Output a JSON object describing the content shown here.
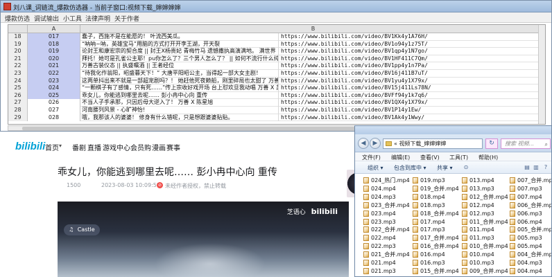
{
  "main_window": {
    "title": "刘八课_词链流_爆款仿选器 - 当前子窗口:视频下载_婶婶婶婶",
    "menus": [
      "爆款仿选",
      "调试输出",
      "小工具",
      "法律声明",
      "关于作者"
    ]
  },
  "sheet": {
    "col_headers": [
      "A",
      "B"
    ],
    "rows": [
      {
        "n": "18",
        "a": "017",
        "b": "蠢子，西施不是在能愿的！ 叶流西美瓜。",
        "c": "https://www.bilibili.com/video/BV1Kk4y1A76H/",
        "hl": true
      },
      {
        "n": "19",
        "a": "018",
        "b": "“呐呐~呐，英雄宝马”用脑的方式打开开李王湖，开天裂",
        "c": "https://www.bilibili.com/video/BV1o94y1z75T/",
        "hl": true
      },
      {
        "n": "20",
        "a": "019",
        "b": "论封王和康宏宗的契合度 || 封王X杨贵妃  青梅竹马 遗憾撒执高演满地。 满世界",
        "c": "https://www.bilibili.com/video/BV1qp4y1N7go/",
        "hl": true
      },
      {
        "n": "21",
        "a": "020",
        "b": "拜托！她可是孔雀公主耶！pu你怎么了？三个男人怎么了？ || 如何不流行什么纯爱，我",
        "c": "https://www.bilibili.com/video/BV1HF411C7Qm/",
        "hl": true
      },
      {
        "n": "22",
        "a": "021",
        "b": "万善古装仪态 || 执盛嘱酒 || 王者经位",
        "c": "https://www.bilibili.com/video/BV1pp4y1n7Pa/",
        "hl": true
      },
      {
        "n": "23",
        "a": "022",
        "b": "“待我化作翁阳，昭盛暮天下！” 大唐平阳昭公主，当得起一部大女主剧！",
        "c": "https://www.bilibili.com/video/BV16j411B7uT/",
        "hl": true
      },
      {
        "n": "24",
        "a": "023",
        "b": "这两单抖出来不就是一部超宠剧吗？！ 她赶他死夜赖船，刚里碎局也太甜了 万善 X 吴",
        "c": "https://www.bilibili.com/video/BV1yu4y1X79x/",
        "hl": true
      },
      {
        "n": "25",
        "a": "024",
        "b": "“一颗棋子有了感情，只有死……”传上宗收好戏开场  台上怼欢旦我动唱  万善 X 苏雅",
        "c": "https://www.bilibili.com/video/BV15j411Ls78N/",
        "hl": true
      },
      {
        "n": "26",
        "a": "025",
        "b": "乖女儿，你能逃到哪里去呢…… 彭小冉中心向  重传",
        "c": "https://www.bilibili.com/video/BVFf94y1k7q6/",
        "hl": true
      },
      {
        "n": "27",
        "a": "026",
        "b": "不当人子手承那，只因后母大逆入了！  万善 X 陈星旭",
        "c": "https://www.bilibili.com/video/BV1QX4y1X79x/",
        "hl": false
      },
      {
        "n": "28",
        "a": "027",
        "b": "河南腰列风景 - 心旷神怡!",
        "c": "https://www.bilibili.com/video/BV1P14y1Ew/",
        "hl": false
      },
      {
        "n": "29",
        "a": "028",
        "b": "哦，我那该人的婆婆！ 修身有什么错呢，只是想跟婆婆贴贴。",
        "c": "https://www.bilibili.com/video/BV1Ak4y1Wwy/",
        "hl": false
      }
    ]
  },
  "bili_nav": {
    "logo": "bilibili",
    "items": [
      "首页",
      "番剧",
      "直播",
      "游戏中心",
      "会员购",
      "漫画",
      "赛事"
    ]
  },
  "video": {
    "title": "乖女儿，你能逃到哪里去呢…… 彭小冉中心向 重传",
    "views": "1500",
    "datetime": "2023-08-03 10:09:57",
    "notice": "未经作者授权，禁止转载",
    "watermark_small": "芝语心",
    "watermark_logo": "bilibili",
    "music": "Castle"
  },
  "explorer": {
    "address": "« 视频下载_婶婶婶婶",
    "search_placeholder": "搜索 视频...",
    "menus": [
      "文件(F)",
      "编辑(E)",
      "查看(V)",
      "工具(T)",
      "帮助(H)"
    ],
    "toolbar": [
      "组织 ▾",
      "包含到库中 ▾",
      "共享 ▾"
    ],
    "files": [
      [
        "024_热门.mp4",
        "019.mp3",
        "013.mp4",
        "007_合并.mp4"
      ],
      [
        "024.mp4",
        "019_合并.mp4",
        "013.mp3",
        "007.mp3"
      ],
      [
        "024.mp3",
        "018.mp4",
        "012_合并.mp4",
        "007.mp4"
      ],
      [
        "023_合并.mp4",
        "018.mp3",
        "012.mp4",
        "006_合并.mp4"
      ],
      [
        "023.mp4",
        "018_合并.mp4",
        "012.mp3",
        "006.mp3"
      ],
      [
        "023.mp3",
        "017.mp4",
        "011_合并.mp4",
        "006.mp4"
      ],
      [
        "022_合并.mp4",
        "017.mp3",
        "011.mp4",
        "005_合并.mp4"
      ],
      [
        "022.mp4",
        "017_合并.mp4",
        "011.mp3",
        "005.mp3"
      ],
      [
        "022.mp3",
        "016_合并.mp4",
        "010_合并.mp4",
        "005.mp4"
      ],
      [
        "021_合并.mp4",
        "016.mp4",
        "010.mp4",
        "004_合并.mp4"
      ],
      [
        "021.mp4",
        "016.mp3",
        "010.mp3",
        "004.mp3"
      ],
      [
        "021.mp3",
        "015_合并.mp4",
        "009_合并.mp4",
        "004.mp4"
      ]
    ]
  }
}
